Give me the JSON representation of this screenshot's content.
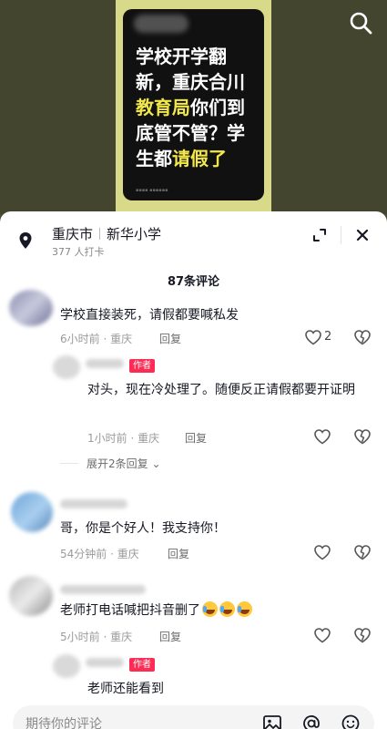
{
  "video": {
    "cover_lines": [
      "学校开学翻",
      "新，重庆合川",
      "教育局",
      "你们到",
      "底管不管？学",
      "生都",
      "请假了"
    ]
  },
  "location": {
    "city": "重庆市",
    "place": "新华小学",
    "checkins": "377 人打卡"
  },
  "comments_count": "87条评论",
  "comments": [
    {
      "text": "学校直接装死，请假都要喊私发",
      "meta": "6小时前 · 重庆",
      "reply": "回复",
      "likes": "2"
    },
    {
      "author_tag": "作者",
      "text": "对头，现在冷处理了。随便反正请假都要开证明",
      "meta": "1小时前 · 重庆",
      "reply": "回复",
      "expand": "展开2条回复"
    },
    {
      "text": "哥，你是个好人！我支持你！",
      "meta": "54分钟前 · 重庆",
      "reply": "回复"
    },
    {
      "text": "老师打电话喊把抖音删了",
      "meta": "5小时前 · 重庆",
      "reply": "回复"
    },
    {
      "author_tag": "作者",
      "text": "老师还能看到"
    }
  ],
  "input": {
    "placeholder": "期待你的评论"
  },
  "icons": {
    "search": "search-icon",
    "location": "location-pin-icon",
    "expand": "expand-icon",
    "close": "close-icon",
    "like": "heart-icon",
    "dislike": "broken-heart-icon",
    "image": "image-icon",
    "mention": "at-icon",
    "emoji": "emoji-icon"
  },
  "colors": {
    "author_tag": "#fe2c55",
    "highlight": "#f3e84b"
  }
}
